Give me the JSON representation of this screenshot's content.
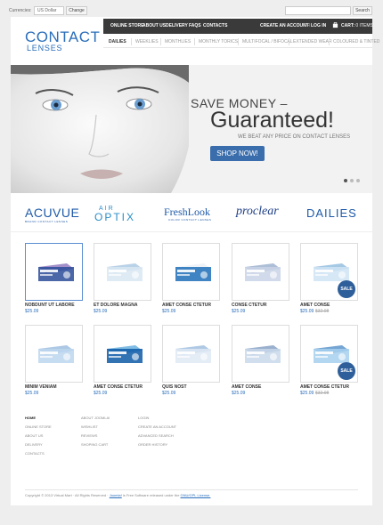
{
  "topbar": {
    "currencies_label": "Currencies:",
    "currency_value": "US Dollar",
    "change_button": "Change",
    "search_button": "Search",
    "search_placeholder": ""
  },
  "logo": {
    "line1": "CONTACT",
    "line2": "LENSES"
  },
  "nav": {
    "items": [
      "ONLINE STORE",
      "ABOUT US",
      "DELIVERY",
      "FAQS",
      "CONTACTS"
    ],
    "create_account": "CREATE AN ACCOUNT",
    "or": "OR",
    "login": "LOG IN",
    "cart_label": "CART:",
    "cart_value": "0 ITEMS"
  },
  "categories": [
    "DAILIES",
    "WEEKLIES",
    "MONTHLIES",
    "MONTHLY TORICS",
    "MULTIFOCAL / BIFOCAL",
    "EXTENDED WEAR",
    "COLOURED & TINTED"
  ],
  "banner": {
    "save_money": "SAVE MONEY –",
    "guaranteed": "Guaranteed!",
    "tagline": "WE BEAT ANY PRICE ON CONTACT LENSES",
    "shop_button": "SHOP NOW!",
    "active_slide": 1,
    "slide_count": 3
  },
  "brands": {
    "acuvue": "ACUVUE",
    "acuvue_sub": "BRAND CONTACT LENSES",
    "air": "AIR",
    "optix": "OPTIX",
    "freshlook": "FreshLook",
    "freshlook_sub": "COLOR CONTACT LENSES",
    "proclear": "proclear",
    "dailies": "DAILIES"
  },
  "products": [
    {
      "name": "NOBDUNT UT LABORE",
      "price": "$25.09",
      "old_price": "",
      "sale": false,
      "icon": "lens-box-icon",
      "selected": true
    },
    {
      "name": "ET DOLORE MAGNA",
      "price": "$25.09",
      "old_price": "",
      "sale": false,
      "icon": "lens-box-icon"
    },
    {
      "name": "AMET CONSE CTETUR",
      "price": "$25.09",
      "old_price": "",
      "sale": false,
      "icon": "lens-box-icon"
    },
    {
      "name": "CONSE CTETUR",
      "price": "$25.09",
      "old_price": "",
      "sale": false,
      "icon": "lens-box-icon"
    },
    {
      "name": "AMET CONSE",
      "price": "$25.09",
      "old_price": "$32.98",
      "sale": true,
      "sale_label": "SALE",
      "icon": "lens-box-icon"
    },
    {
      "name": "MINIM VENIAM",
      "price": "$25.09",
      "old_price": "",
      "sale": false,
      "icon": "lens-box-icon"
    },
    {
      "name": "AMET CONSE CTETUR",
      "price": "$25.09",
      "old_price": "",
      "sale": false,
      "icon": "lens-box-icon"
    },
    {
      "name": "QUIS NOST",
      "price": "$25.09",
      "old_price": "",
      "sale": false,
      "icon": "lens-box-icon"
    },
    {
      "name": "AMET CONSE",
      "price": "$25.09",
      "old_price": "",
      "sale": false,
      "icon": "lens-box-icon"
    },
    {
      "name": "AMET CONSE CTETUR",
      "price": "$25.09",
      "old_price": "$32.98",
      "sale": true,
      "sale_label": "SALE",
      "icon": "lens-box-icon"
    }
  ],
  "footer": {
    "col1": [
      "HOME",
      "ONLINE STORE",
      "ABOUT US",
      "DELIVERY",
      "CONTACTS"
    ],
    "col2": [
      "ABOUT JOOMLA!",
      "WISHLIST",
      "REVIEWS",
      "SHOPING CART"
    ],
    "col3": [
      "LOGIN",
      "CREATE AN ACCOUNT",
      "ADVANCED SEARCH",
      "ORDER HISTORY"
    ],
    "copyright_text": "Copyright © 2013 Virtual Mart · All Rights Reserved · ",
    "joomla_link": "Joomla!",
    "copyright_mid": " is Free Software released under the ",
    "license_link": "GNU/GPL License."
  },
  "colors": {
    "brand_blue": "#2a6ebb",
    "nav_dark": "#3a3a3a",
    "shop_button": "#3a6dab",
    "sale_badge": "#2f5f9a"
  }
}
